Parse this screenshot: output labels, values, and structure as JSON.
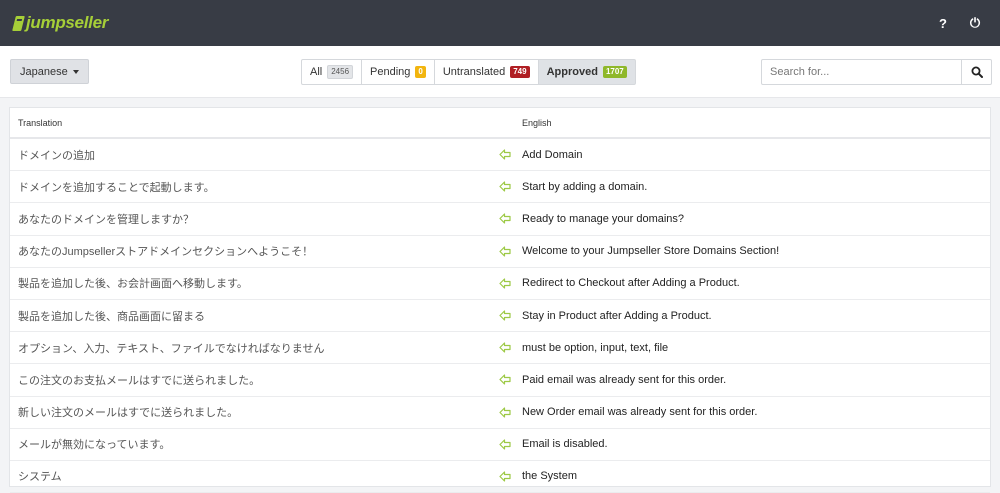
{
  "header": {
    "logo_text": "jumpseller",
    "help_icon": "?",
    "power_icon": "⏻"
  },
  "toolbar": {
    "language": "Japanese",
    "filters": [
      {
        "label": "All",
        "count": "2456",
        "color": "#e3e5e8"
      },
      {
        "label": "Pending",
        "count": "0",
        "color": "#f2b50f"
      },
      {
        "label": "Untranslated",
        "count": "749",
        "color": "#b01f24"
      },
      {
        "label": "Approved",
        "count": "1707",
        "color": "#8fb82a",
        "active": true
      }
    ],
    "search_placeholder": "Search for..."
  },
  "table": {
    "columns": {
      "translation": "Translation",
      "english": "English"
    },
    "rows": [
      {
        "translation": "ドメインの追加",
        "english": "Add Domain"
      },
      {
        "translation": "ドメインを追加することで起動します。",
        "english": "Start by adding a domain."
      },
      {
        "translation": "あなたのドメインを管理しますか？",
        "english": "Ready to manage your domains?"
      },
      {
        "translation": "あなたのJumpsellerストアドメインセクションへようこそ！",
        "english": "Welcome to your Jumpseller Store Domains Section!"
      },
      {
        "translation": "製品を追加した後、お会計画面へ移動します。",
        "english": "Redirect to Checkout after Adding a Product."
      },
      {
        "translation": "製品を追加した後、商品画面に留まる",
        "english": "Stay in Product after Adding a Product."
      },
      {
        "translation": "オプション、入力、テキスト、ファイルでなければなりません",
        "english": "must be option, input, text, file"
      },
      {
        "translation": "この注文のお支払メールはすでに送られました。",
        "english": "Paid email was already sent for this order."
      },
      {
        "translation": "新しい注文のメールはすでに送られました。",
        "english": "New Order email was already sent for this order."
      },
      {
        "translation": "メールが無効になっています。",
        "english": "Email is disabled."
      },
      {
        "translation": "システム",
        "english": "the System"
      }
    ]
  }
}
